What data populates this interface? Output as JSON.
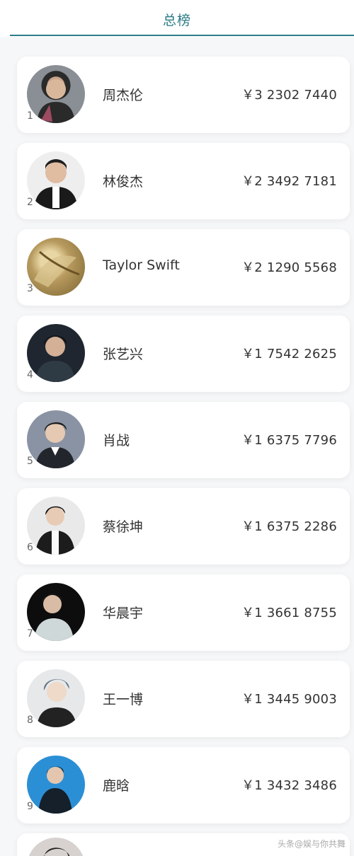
{
  "header": {
    "title": "总榜"
  },
  "ranking": [
    {
      "rank": "1",
      "name": "周杰伦",
      "amount": "￥3 2302 7440"
    },
    {
      "rank": "2",
      "name": "林俊杰",
      "amount": "￥2 3492 7181"
    },
    {
      "rank": "3",
      "name": "Taylor Swift",
      "amount": "￥2 1290 5568"
    },
    {
      "rank": "4",
      "name": "张艺兴",
      "amount": "￥1 7542 2625"
    },
    {
      "rank": "5",
      "name": "肖战",
      "amount": "￥1 6375 7796"
    },
    {
      "rank": "6",
      "name": "蔡徐坤",
      "amount": "￥1 6375 2286"
    },
    {
      "rank": "7",
      "name": "华晨宇",
      "amount": "￥1 3661 8755"
    },
    {
      "rank": "8",
      "name": "王一博",
      "amount": "￥1 3445 9003"
    },
    {
      "rank": "9",
      "name": "鹿晗",
      "amount": "￥1 3432 3486"
    }
  ],
  "watermark": "头条@娱与你共舞",
  "colors": {
    "accent": "#2e7d8a",
    "title": "#2b7a86"
  }
}
